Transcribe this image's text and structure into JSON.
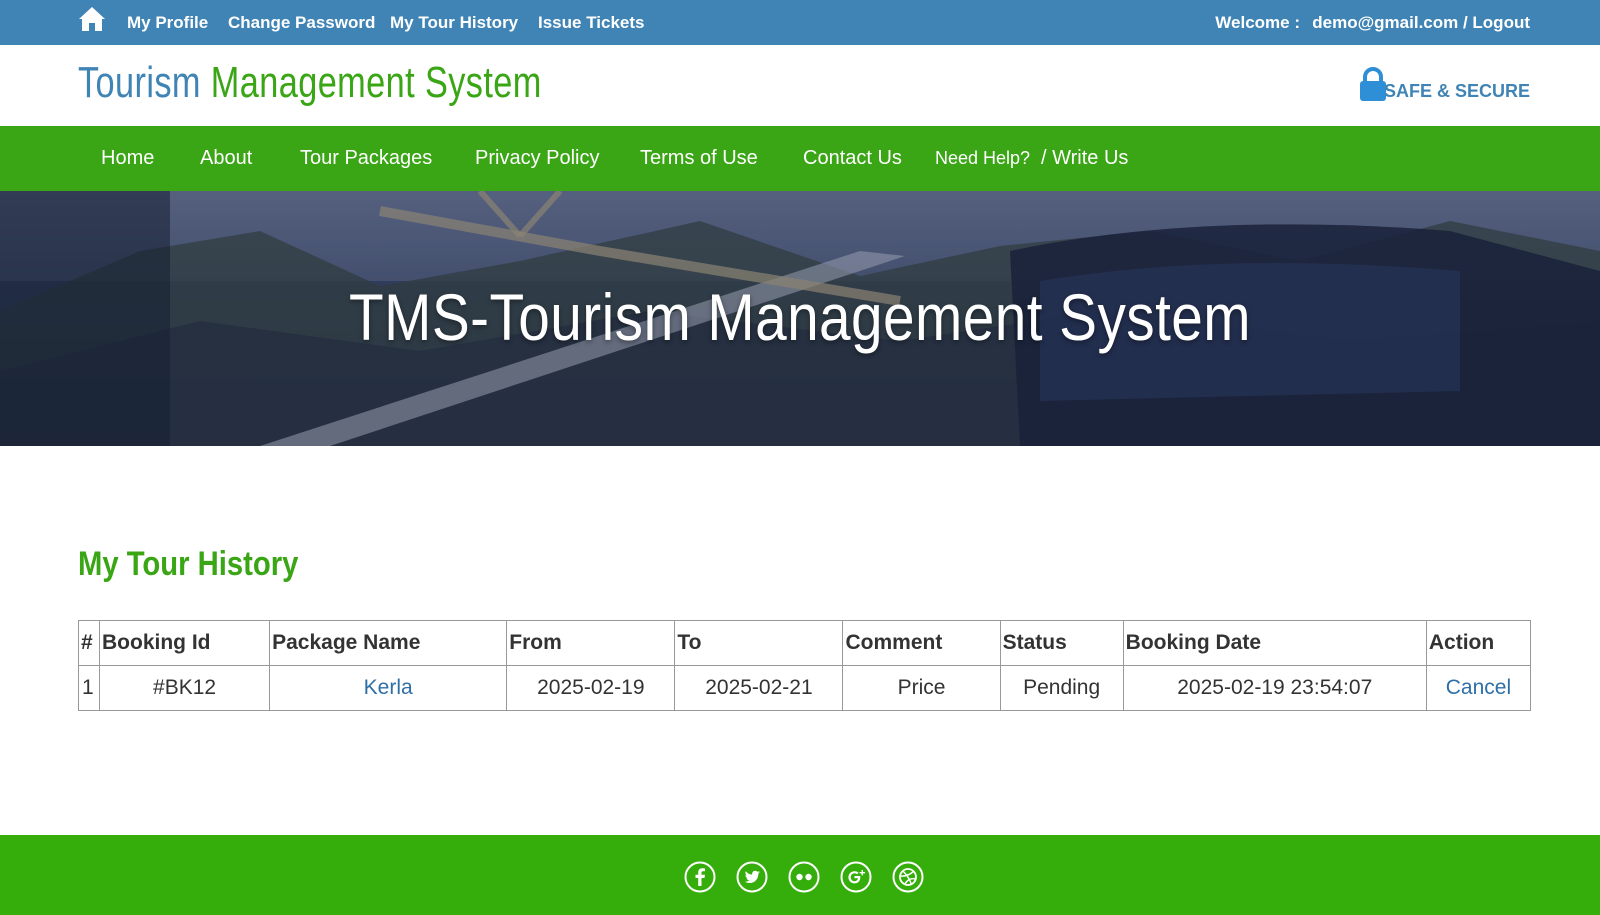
{
  "topbar": {
    "links": [
      "My Profile",
      "Change Password",
      "My Tour History",
      "Issue Tickets"
    ],
    "welcome": "Welcome :",
    "account": "demo@gmail.com / Logout"
  },
  "header": {
    "logo_part1": "Tourism",
    "logo_part2": "Management System",
    "secure_label": "SAFE & SECURE"
  },
  "nav": {
    "items": [
      "Home",
      "About",
      "Tour Packages",
      "Privacy Policy",
      "Terms of Use",
      "Contact Us"
    ],
    "help": "Need Help?",
    "write": "/ Write Us"
  },
  "banner": {
    "title": "TMS-Tourism Management System"
  },
  "main": {
    "title": "My Tour History",
    "columns": [
      "#",
      "Booking Id",
      "Package Name",
      "From",
      "To",
      "Comment",
      "Status",
      "Booking Date",
      "Action"
    ],
    "rows": [
      [
        "1",
        "#BK12",
        "Kerla",
        "2025-02-19",
        "2025-02-21",
        "Price",
        "Pending",
        "2025-02-19 23:54:07",
        "Cancel"
      ]
    ]
  },
  "footer": {
    "social": [
      "facebook-icon",
      "twitter-icon",
      "flickr-icon",
      "google-plus-icon",
      "dribbble-icon"
    ]
  },
  "colors": {
    "blue": "#3f84b4",
    "green": "#3aa515",
    "footer_green": "#35ad0a",
    "link": "#2f6fa8"
  }
}
